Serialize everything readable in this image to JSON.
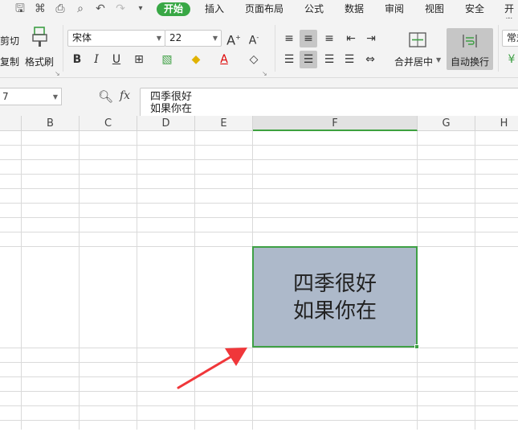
{
  "menubar": {
    "tabs": [
      "开始",
      "插入",
      "页面布局",
      "公式",
      "数据",
      "审阅",
      "视图",
      "安全",
      "开发"
    ]
  },
  "ribbon": {
    "cut_label": "剪切",
    "copy_label": "复制",
    "format_painter_label": "格式刷",
    "font_name": "宋体",
    "font_size": "22",
    "merge_center_label": "合并居中",
    "wrap_text_label": "自动换行",
    "number_format_label": "常规"
  },
  "formula_bar": {
    "name_box": "7",
    "fx_label": "fx",
    "content_line1": "四季很好",
    "content_line2": "如果你在"
  },
  "columns": [
    "B",
    "C",
    "D",
    "E",
    "F",
    "G",
    "H"
  ],
  "cell": {
    "line1": "四季很好",
    "line2": "如果你在",
    "fill_color": "#adb9ca",
    "border_color": "#3fa045"
  },
  "colors": {
    "accent": "#38a745",
    "arrow": "#f0373a"
  }
}
